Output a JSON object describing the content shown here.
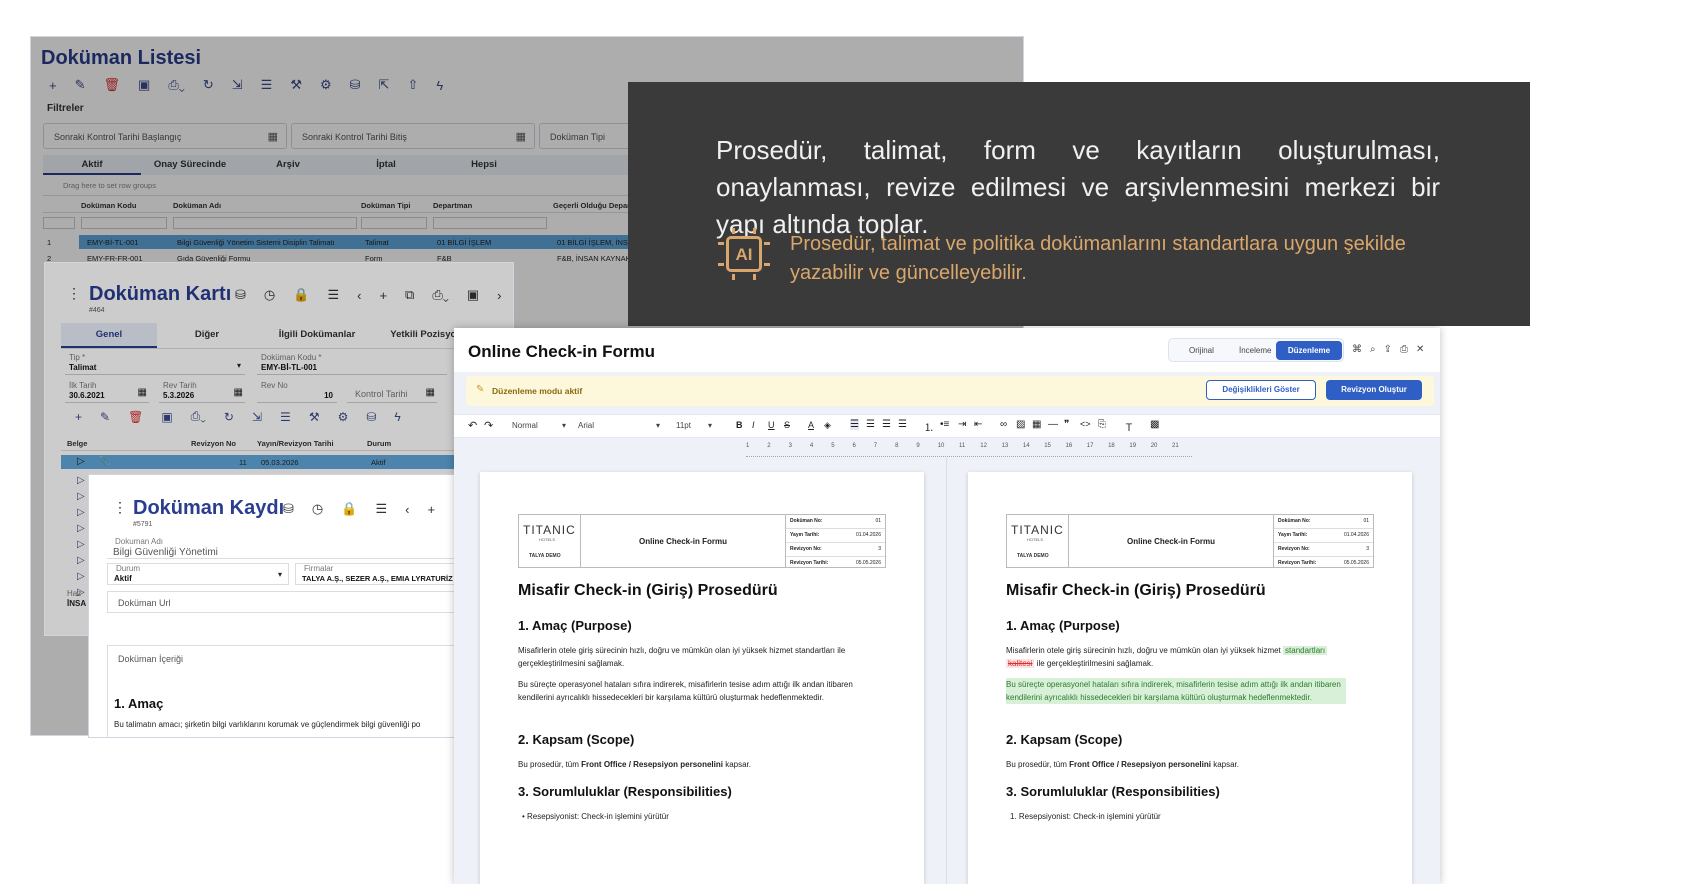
{
  "doc_list": {
    "title": "Doküman Listesi",
    "filters_label": "Filtreler",
    "filter_start": "Sonraki Kontrol Tarihi Başlangıç",
    "filter_end": "Sonraki Kontrol Tarihi Bitiş",
    "filter_type": "Doküman Tipi",
    "tabs": [
      "Aktif",
      "Onay Sürecinde",
      "Arşiv",
      "İptal",
      "Hepsi"
    ],
    "group_hint": "Drag here to set row groups",
    "columns": [
      "Doküman Kodu",
      "Doküman Adı",
      "Doküman Tipi",
      "Departman",
      "Geçerli Olduğu Departmanlar"
    ],
    "rows": [
      {
        "no": "1",
        "code": "EMY-Bİ-TL-001",
        "name": "Bilgi Güvenliği Yönetim Sistemi Disiplin Talimatı",
        "type": "Talimat",
        "dept": "01 BİLGİ İŞLEM",
        "valid": "01 BİLGİ İŞLEM, İNSAN"
      },
      {
        "no": "2",
        "code": "EMY-FR-FR-001",
        "name": "Gıda Güvenliği Formu",
        "type": "Form",
        "dept": "F&B",
        "valid": "F&B, İNSAN KAYNAKL"
      }
    ]
  },
  "doc_card": {
    "title": "Doküman Kartı",
    "record_id": "#464",
    "tabs": [
      "Genel",
      "Diğer",
      "İlgili Dokümanlar",
      "Yetkili Pozisyonlar"
    ],
    "type_label": "Tip *",
    "type_value": "Talimat",
    "code_label": "Doküman Kodu *",
    "code_value": "EMY-Bİ-TL-001",
    "first_date_label": "İlk Tarih",
    "first_date_value": "30.6.2021",
    "rev_date_label": "Rev Tarih",
    "rev_date_value": "5.3.2026",
    "rev_no_label": "Rev No",
    "rev_no_value": "10",
    "control_date_label": "Kontrol Tarihi",
    "grid_columns": [
      "Belge",
      "Revizyon No",
      "Yayın/Revizyon Tarihi",
      "Durum"
    ],
    "grid_row": {
      "rev": "11",
      "date": "05.03.2026",
      "status": "Aktif"
    },
    "side_label_1": "Haz",
    "side_label_2": "İNSA"
  },
  "doc_record": {
    "title": "Doküman Kaydı",
    "record_id": "#5791",
    "name_label": "Dokuman Adı",
    "name_value": "Bilgi Güvenliği Yönetimi",
    "status_label": "Durum",
    "status_value": "Aktif",
    "firms_label": "Firmalar",
    "firms_value": "TALYA A.Ş., SEZER A.Ş., EMIA LYRATURİZ",
    "url_placeholder": "Doküman Url",
    "content_label": "Doküman İçeriği",
    "heading": "1. Amaç",
    "body": "Bu talimatın amacı; şirketin bilgi varlıklarını korumak ve güçlendirmek bilgi güvenliği po"
  },
  "banner": {
    "headline": "Prosedür, talimat, form ve kayıtların oluşturulması, onaylanması, revize edilmesi ve arşivlenmesini merkezi bir yapı altında toplar.",
    "ai_badge": "AI",
    "ai_text": "Prosedür, talimat ve politika dokümanlarını standartlara uygun şekilde yazabilir ve güncelleyebilir.",
    "colors": {
      "bg": "#3a3a3a",
      "accent": "#d9a66b"
    }
  },
  "editor": {
    "title": "Online Check-in Formu",
    "mode_buttons": [
      "Orijinal",
      "İnceleme",
      "Düzenleme"
    ],
    "active_mode": "Düzenleme",
    "edit_notice": "Düzenleme modu aktif",
    "show_changes": "Değişiklikleri Göster",
    "create_revision": "Revizyon Oluştur",
    "style_value": "Normal",
    "font_value": "Arial",
    "size_value": "11pt",
    "ruler": [
      "1",
      "2",
      "3",
      "4",
      "5",
      "6",
      "7",
      "8",
      "9",
      "10",
      "11",
      "12",
      "13",
      "14",
      "15",
      "16",
      "17",
      "18",
      "19",
      "20",
      "21"
    ],
    "colors": {
      "primary": "#2f5fc4",
      "notice_bg": "#fdf8dc",
      "insert": "#d7f0d7",
      "delete": "#d93030"
    }
  },
  "document": {
    "logo": "TITANIC",
    "logo_sub": "HOTELS",
    "logo_caption": "TALYA DEMO",
    "header_title": "Online Check-in Formu",
    "meta": [
      {
        "k": "Doküman No:",
        "v": "01"
      },
      {
        "k": "Yayın Tarihi:",
        "v": "01.04.2026"
      },
      {
        "k": "Revizyon No:",
        "v": "3"
      },
      {
        "k": "Revizyon Tarihi:",
        "v": "05.05.2026"
      }
    ],
    "heading": "Misafir Check-in (Giriş) Prosedürü",
    "s1": "1. Amaç (Purpose)",
    "p1": "Misafirlerin otele giriş sürecinin hızlı, doğru ve mümkün olan iyi yüksek hizmet standartları ile gerçekleştirilmesini sağlamak.",
    "p2": "Bu süreçte operasyonel hataları sıfıra indirerek, misafirlerin tesise adım attığı ilk andan itibaren kendilerini ayrıcalıklı hissedecekleri bir karşılama kültürü oluşturmak hedeflenmektedir.",
    "s2": "2. Kapsam (Scope)",
    "p3_a": "Bu prosedür, tüm ",
    "p3_b": "Front Office / Resepsiyon personelini",
    "p3_c": " kapsar.",
    "s3": "3. Sorumluluklar (Responsibilities)",
    "li_left": "• Resepsiyonist: Check-in işlemini yürütür",
    "li_right": "1. Resepsiyonist: Check-in işlemini yürütür",
    "rev_p1_a": "Misafirlerin otele giriş sürecinin hızlı, doğru ve mümkün olan ",
    "rev_p1_b": "iyi yüksek hizmet",
    "rev_ins": "standartları",
    "rev_del": "kalitesi",
    "rev_p1_c": " ile gerçekleştirilmesini sağlamak."
  }
}
